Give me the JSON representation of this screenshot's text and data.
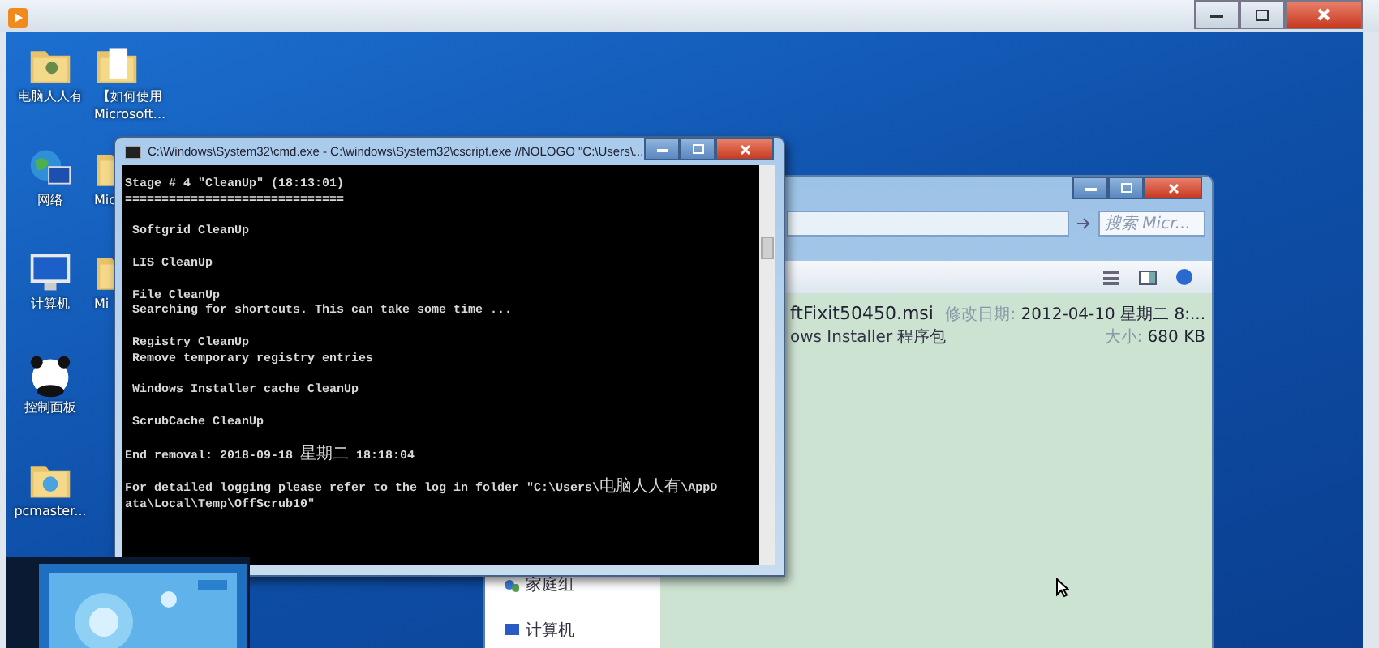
{
  "desktop_columns": [
    [
      {
        "kind": "user-folder",
        "lines": [
          "电脑人人有"
        ]
      },
      {
        "kind": "network",
        "lines": [
          "网络"
        ]
      },
      {
        "kind": "computer",
        "lines": [
          "计算机"
        ]
      },
      {
        "kind": "panda",
        "lines": [
          "控制面板"
        ]
      },
      {
        "kind": "disc-folder",
        "lines": [
          "pcmaster..."
        ]
      }
    ],
    [
      {
        "kind": "document-folder",
        "lines": [
          "【如何使用",
          "Microsoft..."
        ]
      },
      {
        "kind": "folder",
        "lines": [
          "Mic"
        ]
      },
      {
        "kind": "folder",
        "lines": [
          "Mi"
        ]
      }
    ]
  ],
  "explorer": {
    "search": {
      "placeholder": "搜索 Micr..."
    },
    "file": {
      "name": "ftFixit50450.msi",
      "type": "ows Installer 程序包",
      "modified_label": "修改日期:",
      "modified": "2012-04-10 星期二 8:...",
      "size_label": "大小:",
      "size": "680 KB"
    },
    "nav_items": [
      {
        "kind": "homegroup",
        "label": "家庭组"
      },
      {
        "kind": "computer",
        "label": "计算机"
      }
    ]
  },
  "console": {
    "title": "C:\\Windows\\System32\\cmd.exe - C:\\windows\\System32\\cscript.exe //NOLOGO \"C:\\Users\\...",
    "blocks": [
      [
        "Stage # 4 \"CleanUp\" (18:13:01)",
        "=============================="
      ],
      [
        " Softgrid CleanUp"
      ],
      [
        " LIS CleanUp"
      ],
      [
        " File CleanUp",
        " Searching for shortcuts. This can take some time ..."
      ],
      [
        " Registry CleanUp",
        " Remove temporary registry entries"
      ],
      [
        " Windows Installer cache CleanUp"
      ],
      [
        " ScrubCache CleanUp"
      ],
      [
        "End removal: 2018-09-18 星期二 18:18:04"
      ],
      [
        "For detailed logging please refer to the log in folder \"C:\\Users\\电脑人人有\\AppD",
        "ata\\Local\\Temp\\OffScrub10\""
      ]
    ]
  }
}
